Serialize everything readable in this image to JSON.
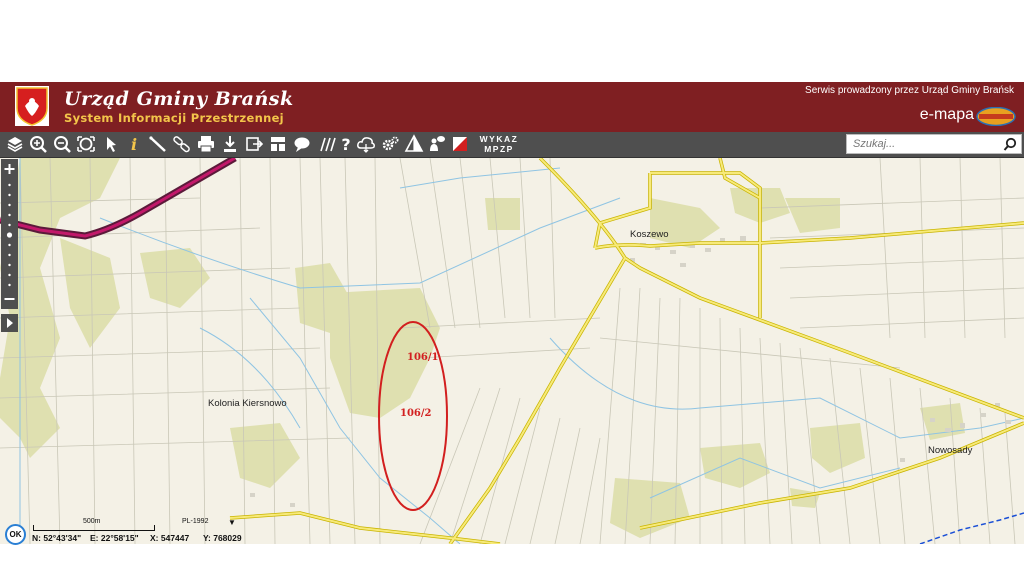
{
  "header": {
    "title": "Urząd Gminy Brańsk",
    "subtitle": "System Informacji Przestrzennej",
    "service_note": "Serwis prowadzony przez Urząd Gminy Brańsk",
    "brand": "e-mapa",
    "colors": {
      "background": "#7f1f22",
      "subtitle": "#f3c54a"
    }
  },
  "toolbar": {
    "tools": [
      "layers-icon",
      "zoom-in-icon",
      "zoom-out-icon",
      "zoom-extent-icon",
      "info-icon",
      "select-arrow-icon",
      "measure-icon",
      "link-icon",
      "print-icon",
      "download-icon",
      "export-icon",
      "layout-icon",
      "comment-icon",
      "hatch-icon",
      "help-icon",
      "cloud-icon",
      "settings-icon",
      "prism-icon",
      "marker-icon",
      "parcel-icon"
    ],
    "wykaz_line1": "WYKAZ",
    "wykaz_line2": "MPZP",
    "search_placeholder": "Szukaj..."
  },
  "map": {
    "places": {
      "koszewo": "Koszewo",
      "kolonia": "Kolonia Kiersnowo",
      "nowosady": "Nowosady"
    },
    "parcels": [
      "106/1",
      "106/2"
    ],
    "highlight_color": "#d21f1f"
  },
  "statusbar": {
    "ok_label": "OK",
    "scale_label": "500m",
    "crs": "PL-1992",
    "lat": "N: 52°43'34\"",
    "lon": "E: 22°58'15\"",
    "x": "X: 547447",
    "y": "Y: 768029"
  }
}
